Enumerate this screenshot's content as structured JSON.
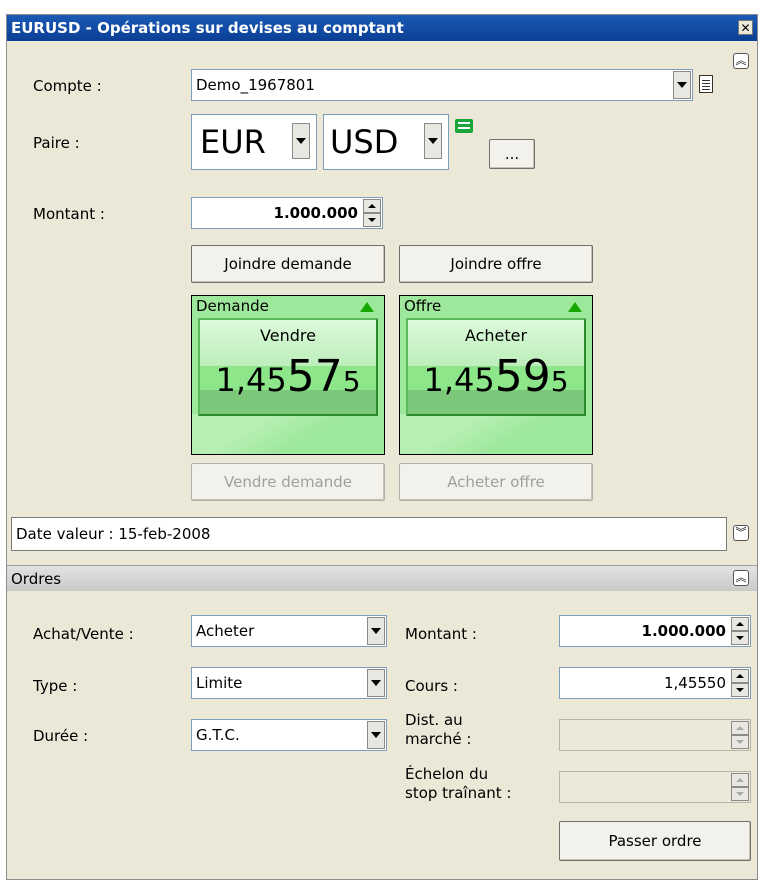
{
  "window": {
    "title": "EURUSD - Opérations sur devises au comptant",
    "close_glyph": "✕"
  },
  "icons": {
    "collapse_up": "︽",
    "collapse_down": "︾"
  },
  "trade": {
    "account_label": "Compte :",
    "account_value": "Demo_1967801",
    "pair_label": "Paire :",
    "base_currency": "EUR",
    "quote_currency": "USD",
    "more_button": "...",
    "amount_label": "Montant :",
    "amount_value": "1.000.000",
    "join_bid_button": "Joindre demande",
    "join_ask_button": "Joindre offre",
    "bid": {
      "header": "Demande",
      "action": "Vendre",
      "price_part1": "1,45",
      "price_part2": "57",
      "price_part3": "5"
    },
    "ask": {
      "header": "Offre",
      "action": "Acheter",
      "price_part1": "1,45",
      "price_part2": "59",
      "price_part3": "5"
    },
    "sell_bid_button": "Vendre demande",
    "buy_ask_button": "Acheter offre",
    "value_date": "Date valeur : 15-feb-2008"
  },
  "orders": {
    "section_title": "Ordres",
    "side_label": "Achat/Vente :",
    "side_value": "Acheter",
    "type_label": "Type :",
    "type_value": "Limite",
    "duration_label": "Durée :",
    "duration_value": "G.T.C.",
    "amount_label": "Montant :",
    "amount_value": "1.000.000",
    "rate_label": "Cours :",
    "rate_value": "1,45550",
    "dist_label_1": "Dist. au",
    "dist_label_2": "marché :",
    "trail_label_1": "Échelon du",
    "trail_label_2": "stop traînant :",
    "place_order_button": "Passer ordre"
  },
  "colors": {
    "titlebar": "#0b3f95",
    "quote_green": "#9ee89c",
    "up_arrow": "#17a800"
  }
}
